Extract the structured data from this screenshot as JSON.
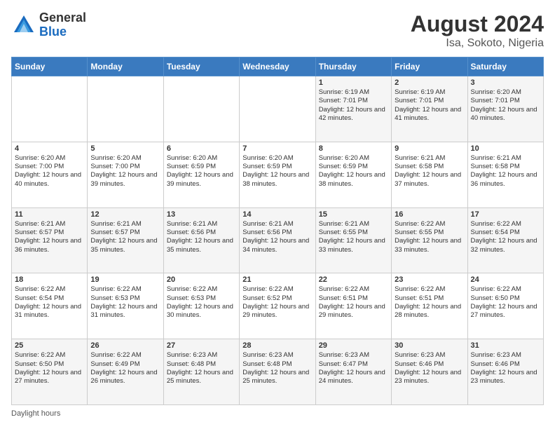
{
  "logo": {
    "general": "General",
    "blue": "Blue"
  },
  "header": {
    "month_year": "August 2024",
    "location": "Isa, Sokoto, Nigeria"
  },
  "days_of_week": [
    "Sunday",
    "Monday",
    "Tuesday",
    "Wednesday",
    "Thursday",
    "Friday",
    "Saturday"
  ],
  "weeks": [
    [
      {
        "day": "",
        "info": ""
      },
      {
        "day": "",
        "info": ""
      },
      {
        "day": "",
        "info": ""
      },
      {
        "day": "",
        "info": ""
      },
      {
        "day": "1",
        "info": "Sunrise: 6:19 AM\nSunset: 7:01 PM\nDaylight: 12 hours\nand 42 minutes."
      },
      {
        "day": "2",
        "info": "Sunrise: 6:19 AM\nSunset: 7:01 PM\nDaylight: 12 hours\nand 41 minutes."
      },
      {
        "day": "3",
        "info": "Sunrise: 6:20 AM\nSunset: 7:01 PM\nDaylight: 12 hours\nand 40 minutes."
      }
    ],
    [
      {
        "day": "4",
        "info": "Sunrise: 6:20 AM\nSunset: 7:00 PM\nDaylight: 12 hours\nand 40 minutes."
      },
      {
        "day": "5",
        "info": "Sunrise: 6:20 AM\nSunset: 7:00 PM\nDaylight: 12 hours\nand 39 minutes."
      },
      {
        "day": "6",
        "info": "Sunrise: 6:20 AM\nSunset: 6:59 PM\nDaylight: 12 hours\nand 39 minutes."
      },
      {
        "day": "7",
        "info": "Sunrise: 6:20 AM\nSunset: 6:59 PM\nDaylight: 12 hours\nand 38 minutes."
      },
      {
        "day": "8",
        "info": "Sunrise: 6:20 AM\nSunset: 6:59 PM\nDaylight: 12 hours\nand 38 minutes."
      },
      {
        "day": "9",
        "info": "Sunrise: 6:21 AM\nSunset: 6:58 PM\nDaylight: 12 hours\nand 37 minutes."
      },
      {
        "day": "10",
        "info": "Sunrise: 6:21 AM\nSunset: 6:58 PM\nDaylight: 12 hours\nand 36 minutes."
      }
    ],
    [
      {
        "day": "11",
        "info": "Sunrise: 6:21 AM\nSunset: 6:57 PM\nDaylight: 12 hours\nand 36 minutes."
      },
      {
        "day": "12",
        "info": "Sunrise: 6:21 AM\nSunset: 6:57 PM\nDaylight: 12 hours\nand 35 minutes."
      },
      {
        "day": "13",
        "info": "Sunrise: 6:21 AM\nSunset: 6:56 PM\nDaylight: 12 hours\nand 35 minutes."
      },
      {
        "day": "14",
        "info": "Sunrise: 6:21 AM\nSunset: 6:56 PM\nDaylight: 12 hours\nand 34 minutes."
      },
      {
        "day": "15",
        "info": "Sunrise: 6:21 AM\nSunset: 6:55 PM\nDaylight: 12 hours\nand 33 minutes."
      },
      {
        "day": "16",
        "info": "Sunrise: 6:22 AM\nSunset: 6:55 PM\nDaylight: 12 hours\nand 33 minutes."
      },
      {
        "day": "17",
        "info": "Sunrise: 6:22 AM\nSunset: 6:54 PM\nDaylight: 12 hours\nand 32 minutes."
      }
    ],
    [
      {
        "day": "18",
        "info": "Sunrise: 6:22 AM\nSunset: 6:54 PM\nDaylight: 12 hours\nand 31 minutes."
      },
      {
        "day": "19",
        "info": "Sunrise: 6:22 AM\nSunset: 6:53 PM\nDaylight: 12 hours\nand 31 minutes."
      },
      {
        "day": "20",
        "info": "Sunrise: 6:22 AM\nSunset: 6:53 PM\nDaylight: 12 hours\nand 30 minutes."
      },
      {
        "day": "21",
        "info": "Sunrise: 6:22 AM\nSunset: 6:52 PM\nDaylight: 12 hours\nand 29 minutes."
      },
      {
        "day": "22",
        "info": "Sunrise: 6:22 AM\nSunset: 6:51 PM\nDaylight: 12 hours\nand 29 minutes."
      },
      {
        "day": "23",
        "info": "Sunrise: 6:22 AM\nSunset: 6:51 PM\nDaylight: 12 hours\nand 28 minutes."
      },
      {
        "day": "24",
        "info": "Sunrise: 6:22 AM\nSunset: 6:50 PM\nDaylight: 12 hours\nand 27 minutes."
      }
    ],
    [
      {
        "day": "25",
        "info": "Sunrise: 6:22 AM\nSunset: 6:50 PM\nDaylight: 12 hours\nand 27 minutes."
      },
      {
        "day": "26",
        "info": "Sunrise: 6:22 AM\nSunset: 6:49 PM\nDaylight: 12 hours\nand 26 minutes."
      },
      {
        "day": "27",
        "info": "Sunrise: 6:23 AM\nSunset: 6:48 PM\nDaylight: 12 hours\nand 25 minutes."
      },
      {
        "day": "28",
        "info": "Sunrise: 6:23 AM\nSunset: 6:48 PM\nDaylight: 12 hours\nand 25 minutes."
      },
      {
        "day": "29",
        "info": "Sunrise: 6:23 AM\nSunset: 6:47 PM\nDaylight: 12 hours\nand 24 minutes."
      },
      {
        "day": "30",
        "info": "Sunrise: 6:23 AM\nSunset: 6:46 PM\nDaylight: 12 hours\nand 23 minutes."
      },
      {
        "day": "31",
        "info": "Sunrise: 6:23 AM\nSunset: 6:46 PM\nDaylight: 12 hours\nand 23 minutes."
      }
    ]
  ],
  "footer": {
    "daylight_hours_label": "Daylight hours"
  }
}
